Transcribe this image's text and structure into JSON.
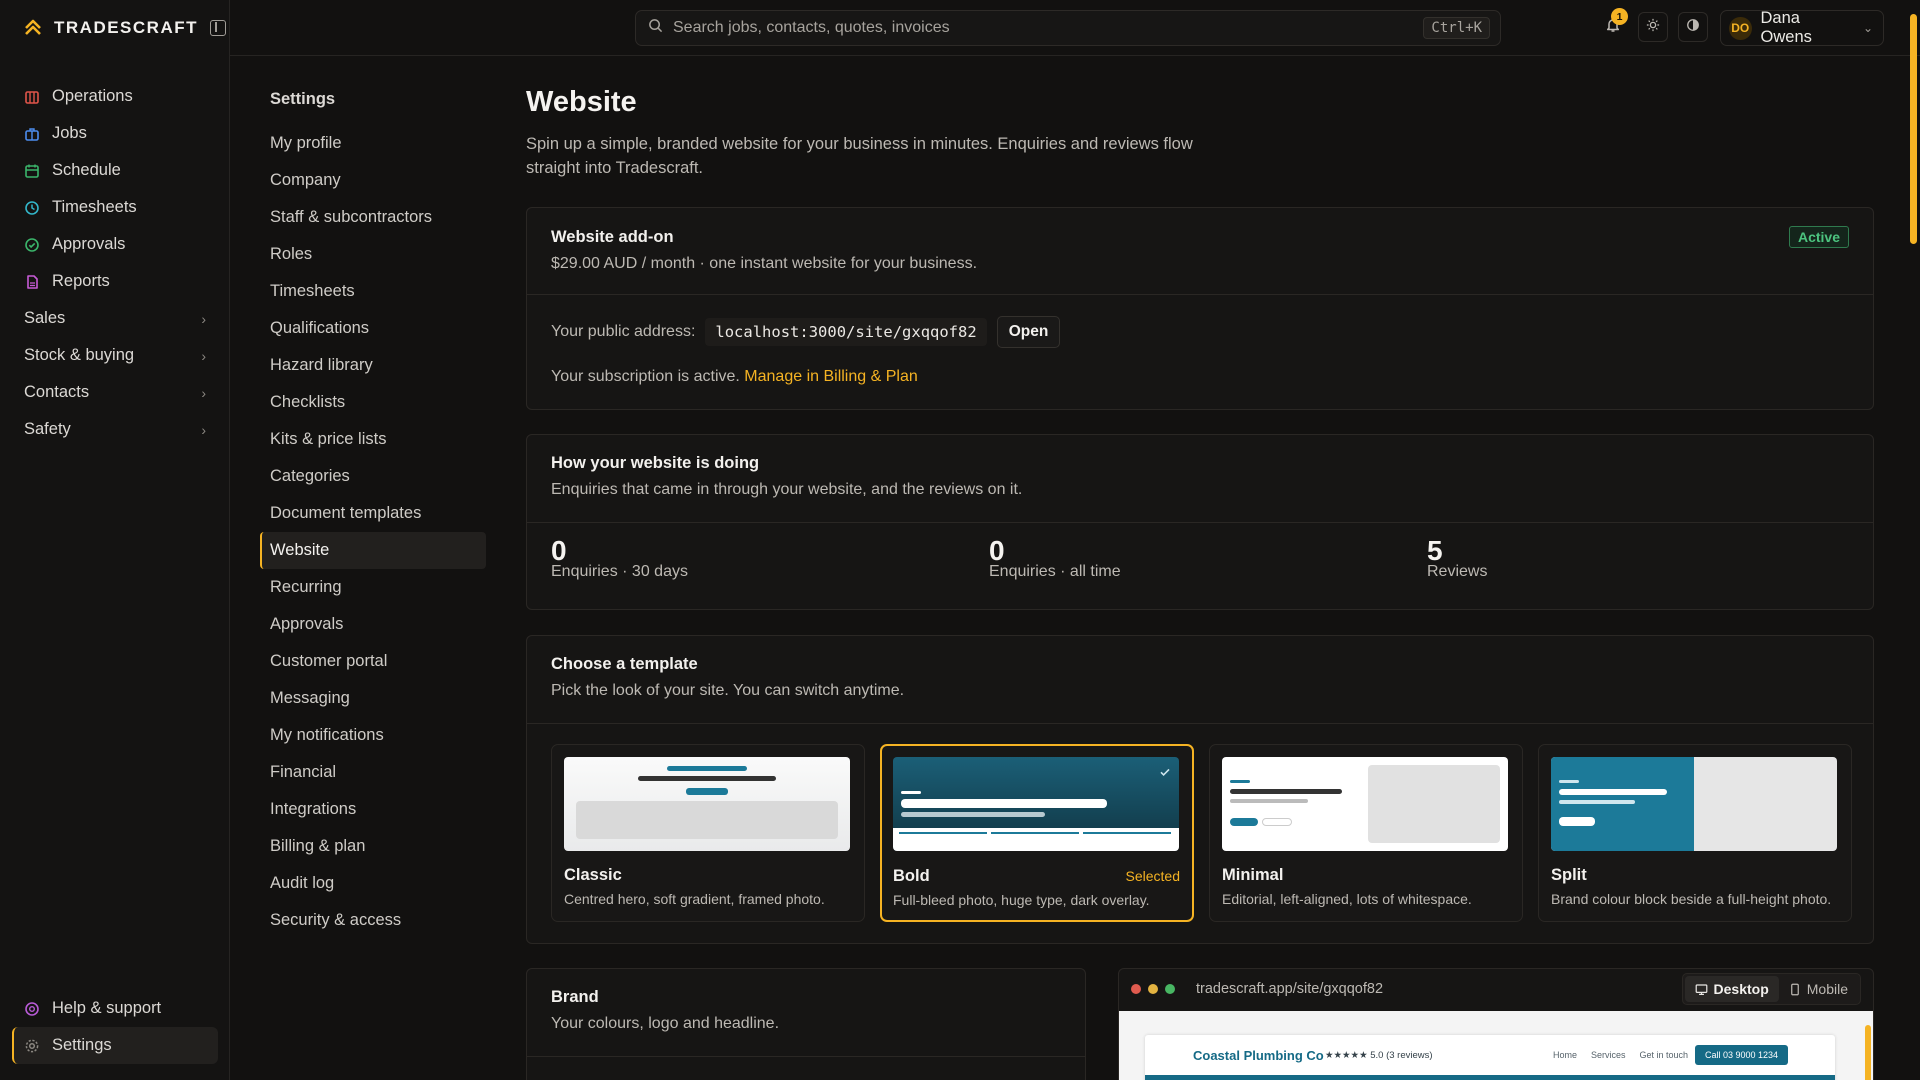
{
  "brand": {
    "name": "TRADESCRAFT"
  },
  "search": {
    "placeholder": "Search jobs, contacts, quotes, invoices",
    "shortcut": "Ctrl+K"
  },
  "notifications": {
    "count": "1"
  },
  "user": {
    "initials": "DO",
    "name": "Dana Owens"
  },
  "sidebar": {
    "items": [
      {
        "label": "Operations",
        "icon": "operations-icon",
        "color": "#e0554a"
      },
      {
        "label": "Jobs",
        "icon": "jobs-icon",
        "color": "#4d8ef0"
      },
      {
        "label": "Schedule",
        "icon": "calendar-icon",
        "color": "#3bb56b"
      },
      {
        "label": "Timesheets",
        "icon": "clock-icon",
        "color": "#33b6c9"
      },
      {
        "label": "Approvals",
        "icon": "check-circle-icon",
        "color": "#3bb56b"
      },
      {
        "label": "Reports",
        "icon": "report-icon",
        "color": "#c75bd6"
      }
    ],
    "groups": [
      {
        "label": "Sales"
      },
      {
        "label": "Stock & buying"
      },
      {
        "label": "Contacts"
      },
      {
        "label": "Safety"
      }
    ],
    "bottom": [
      {
        "label": "Help & support",
        "icon": "help-icon"
      },
      {
        "label": "Settings",
        "icon": "gear-icon"
      }
    ]
  },
  "settings_nav": {
    "title": "Settings",
    "items": [
      "My profile",
      "Company",
      "Staff & subcontractors",
      "Roles",
      "Timesheets",
      "Qualifications",
      "Hazard library",
      "Checklists",
      "Kits & price lists",
      "Categories",
      "Document templates",
      "Website",
      "Recurring",
      "Approvals",
      "Customer portal",
      "Messaging",
      "My notifications",
      "Financial",
      "Integrations",
      "Billing & plan",
      "Audit log",
      "Security & access"
    ],
    "active": "Website"
  },
  "page": {
    "title": "Website",
    "description": "Spin up a simple, branded website for your business in minutes. Enquiries and reviews flow straight into Tradescraft."
  },
  "addon": {
    "title": "Website add-on",
    "price": "$29.00 AUD / month · one instant website for your business.",
    "status": "Active",
    "address_label": "Your public address:",
    "address": "localhost:3000/site/gxqqof82",
    "open_label": "Open",
    "subscription_text": "Your subscription is active.",
    "subscription_link": "Manage in Billing & Plan"
  },
  "stats": {
    "title": "How your website is doing",
    "subtitle": "Enquiries that came in through your website, and the reviews on it.",
    "items": [
      {
        "value": "0",
        "label": "Enquiries · 30 days"
      },
      {
        "value": "0",
        "label": "Enquiries · all time"
      },
      {
        "value": "5",
        "label": "Reviews"
      }
    ]
  },
  "templates": {
    "title": "Choose a template",
    "subtitle": "Pick the look of your site. You can switch anytime.",
    "selected_label": "Selected",
    "items": [
      {
        "name": "Classic",
        "desc": "Centred hero, soft gradient, framed photo."
      },
      {
        "name": "Bold",
        "desc": "Full-bleed photo, huge type, dark overlay."
      },
      {
        "name": "Minimal",
        "desc": "Editorial, left-aligned, lots of whitespace."
      },
      {
        "name": "Split",
        "desc": "Brand colour block beside a full-height photo."
      }
    ],
    "selected_index": 1
  },
  "brand_card": {
    "title": "Brand",
    "subtitle": "Your colours, logo and headline."
  },
  "preview": {
    "url": "tradescraft.app/site/gxqqof82",
    "desktop_label": "Desktop",
    "mobile_label": "Mobile",
    "site_name": "Coastal Plumbing Co",
    "rating": "★★★★★ 5.0 (3 reviews)",
    "nav": [
      "Home",
      "Services",
      "Get in touch"
    ],
    "cta": "Call 03 9000 1234"
  },
  "colors": {
    "accent": "#f5b323",
    "background": "#121110",
    "surface": "#161514",
    "success": "#4cc47f",
    "site_brand": "#156a86"
  }
}
